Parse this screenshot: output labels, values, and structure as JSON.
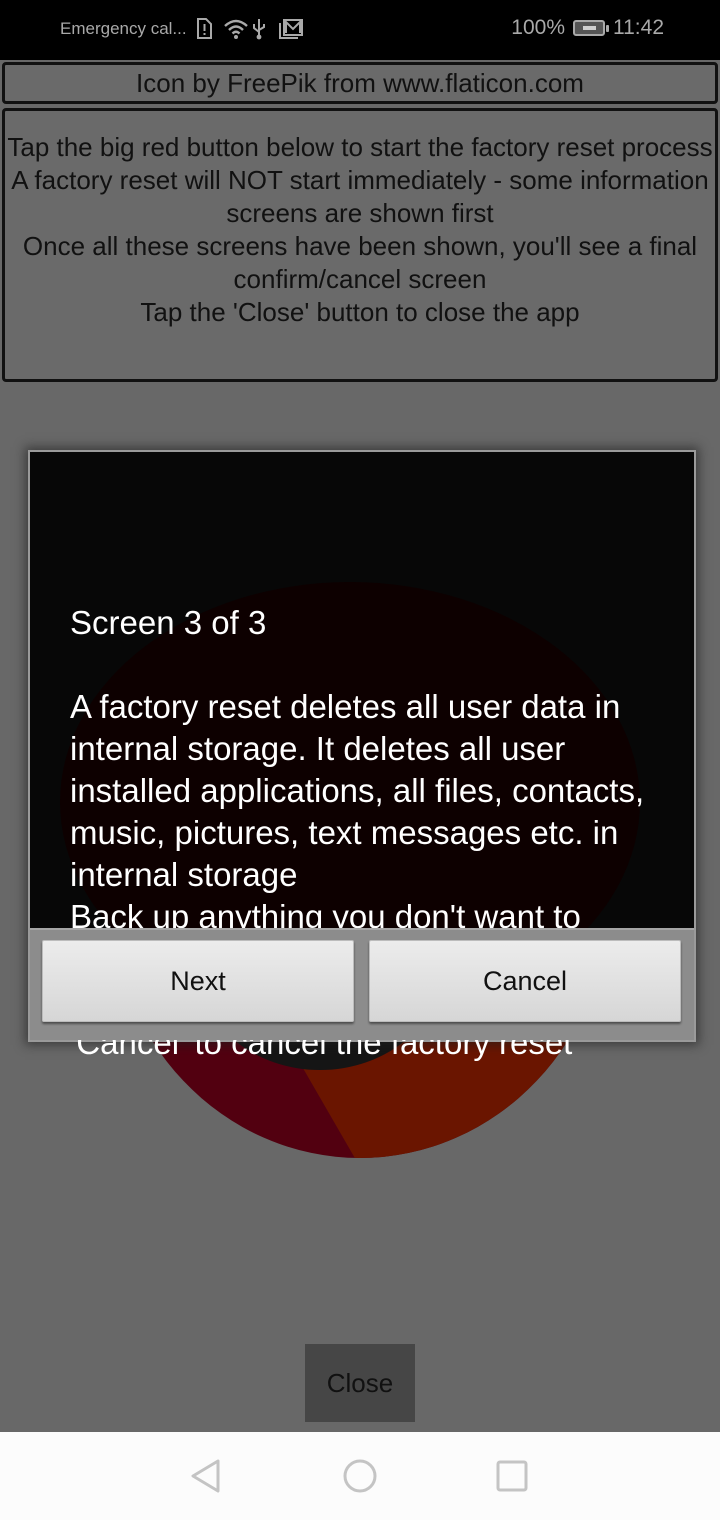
{
  "status_bar": {
    "carrier_text": "Emergency cal...",
    "icons": [
      "sim-alert-icon",
      "wifi-icon",
      "usb-icon",
      "gallery-icon"
    ],
    "battery_percent": "100%",
    "battery_icon": "battery-charging-icon",
    "time": "11:42"
  },
  "app": {
    "credit": "Icon by FreePik from www.flaticon.com",
    "instructions": "Tap the big red button below to start the factory reset process\nA factory reset will NOT start immediately - some information screens are shown first\nOnce all these screens have been shown, you'll see a final confirm/cancel screen\nTap the 'Close' button to close the app",
    "instruction_lines": [
      "Tap the big red button below to start the factory reset process",
      "A factory reset will NOT start immediately - some information screens are shown first",
      "Once all these screens have been shown, you'll see a final confirm/cancel screen",
      "Tap the 'Close' button to close the app"
    ],
    "close_label": "Close",
    "red_button_colors": {
      "main": "#520010",
      "stripe": "#6a1500",
      "center": "#151515"
    }
  },
  "dialog": {
    "title": "Screen 3 of 3",
    "message": "A factory reset deletes all user data in internal storage. It deletes all user installed applications, all files, contacts, music, pictures, text messages etc. in internal storage\nBack up anything you don't want to lose!!!\nTap 'Next' to go the next screen or 'Cancel' to cancel the factory reset",
    "next_label": "Next",
    "cancel_label": "Cancel"
  },
  "nav_bar": {
    "back_icon": "back-triangle-icon",
    "home_icon": "home-circle-icon",
    "recents_icon": "recents-square-icon"
  }
}
